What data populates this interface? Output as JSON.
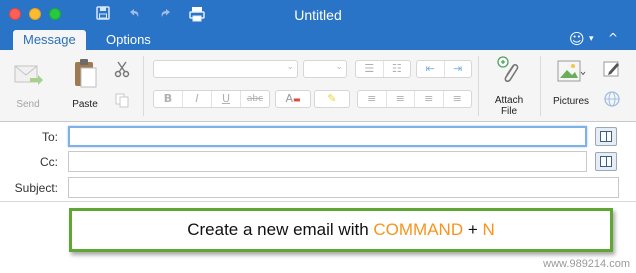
{
  "window": {
    "title": "Untitled",
    "quick_access_icons": [
      "save-icon",
      "undo-icon",
      "redo-icon",
      "print-icon"
    ]
  },
  "tabs": [
    {
      "label": "Message",
      "active": true
    },
    {
      "label": "Options",
      "active": false
    }
  ],
  "tabbar_right": {
    "icons": [
      "smiley-icon",
      "chevron-down-icon",
      "collapse-ribbon-icon"
    ]
  },
  "ribbon": {
    "send_label": "Send",
    "paste_label": "Paste",
    "attach_file_line1": "Attach",
    "attach_file_line2": "File",
    "pictures_label": "Pictures",
    "format_buttons": [
      "B",
      "I",
      "U",
      "abc"
    ]
  },
  "fields": {
    "to_label": "To:",
    "to_value": "",
    "cc_label": "Cc:",
    "cc_value": "",
    "subject_label": "Subject:",
    "subject_value": ""
  },
  "callout": {
    "prefix": "Create a new email with ",
    "key1": "COMMAND",
    "plus": " + ",
    "key2": "N",
    "highlight_color": "#f7941d",
    "border_color": "#5fa635"
  },
  "watermark": "www.989214.com",
  "colors": {
    "titlebar": "#2a74c7",
    "active_tab_text": "#2a6fba"
  }
}
